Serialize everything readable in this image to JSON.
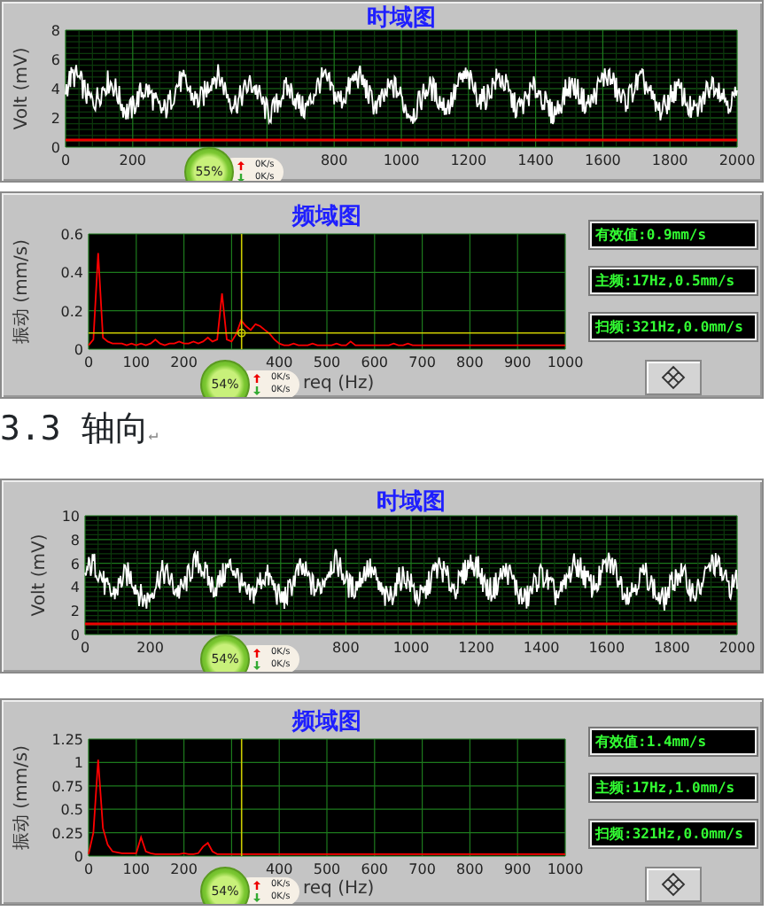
{
  "sections": [
    {
      "kind": "time",
      "title": "时域图",
      "ylabel": "Volt (mV)",
      "yticks": [
        "8",
        "6",
        "4",
        "2",
        "0"
      ],
      "xticks": [
        "0",
        "200",
        "800",
        "1000",
        "1200",
        "1400",
        "1600",
        "1800",
        "2000"
      ],
      "widget": {
        "percent": "55%",
        "up": "0K/s",
        "down": "0K/s"
      }
    },
    {
      "kind": "freq",
      "chart_data": {
        "type": "line",
        "title": "频域图",
        "xlabel": "req (Hz)",
        "ylabel": "振动 (mm/s)",
        "x": [
          0,
          10,
          20,
          30,
          40,
          50,
          60,
          70,
          80,
          90,
          100,
          110,
          120,
          130,
          140,
          150,
          160,
          170,
          180,
          190,
          200,
          210,
          220,
          230,
          240,
          250,
          260,
          270,
          280,
          290,
          300,
          310,
          320,
          330,
          340,
          350,
          360,
          370,
          380,
          390,
          400,
          410,
          420,
          430,
          440,
          450,
          460,
          470,
          480,
          490,
          500,
          510,
          520,
          530,
          540,
          550,
          560,
          570,
          580,
          590,
          600,
          610,
          620,
          630,
          640,
          650,
          660,
          670,
          680,
          690,
          700,
          710,
          720,
          730,
          740,
          750,
          760,
          770,
          780,
          790,
          800,
          810,
          820,
          830,
          840,
          850,
          860,
          870,
          880,
          890,
          900,
          910,
          920,
          930,
          940,
          950,
          960,
          970,
          980,
          990,
          1000
        ],
        "series": [
          {
            "color": "#ff0000",
            "values": [
              0.02,
              0.05,
              0.5,
              0.06,
              0.04,
              0.03,
              0.03,
              0.03,
              0.02,
              0.03,
              0.02,
              0.03,
              0.02,
              0.03,
              0.05,
              0.03,
              0.02,
              0.03,
              0.03,
              0.04,
              0.03,
              0.03,
              0.04,
              0.03,
              0.04,
              0.06,
              0.04,
              0.05,
              0.29,
              0.05,
              0.04,
              0.08,
              0.15,
              0.12,
              0.1,
              0.13,
              0.12,
              0.1,
              0.08,
              0.05,
              0.03,
              0.02,
              0.02,
              0.03,
              0.02,
              0.02,
              0.02,
              0.03,
              0.02,
              0.02,
              0.02,
              0.02,
              0.03,
              0.02,
              0.02,
              0.04,
              0.02,
              0.02,
              0.02,
              0.02,
              0.02,
              0.02,
              0.02,
              0.02,
              0.03,
              0.02,
              0.02,
              0.03,
              0.02,
              0.02,
              0.02,
              0.02,
              0.02,
              0.02,
              0.02,
              0.02,
              0.02,
              0.02,
              0.02,
              0.02,
              0.02,
              0.02,
              0.02,
              0.02,
              0.02,
              0.02,
              0.02,
              0.02,
              0.02,
              0.02,
              0.02,
              0.02,
              0.02,
              0.02,
              0.02,
              0.02,
              0.02,
              0.02,
              0.02,
              0.02,
              0.02
            ]
          }
        ],
        "xlim": [
          0,
          1000
        ],
        "ylim": [
          0,
          0.6
        ],
        "xticks": [
          0,
          100,
          200,
          400,
          500,
          600,
          700,
          800,
          900,
          1000
        ],
        "yticks": [
          0,
          0.2,
          0.4,
          0.6
        ],
        "grid": true,
        "ref_lines": [
          {
            "axis": "x",
            "value": 321,
            "color": "#cccc00"
          },
          {
            "axis": "y",
            "value": 0.084,
            "color": "#cccc00"
          }
        ]
      },
      "readouts": [
        "有效值:0.9mm/s",
        "主频:17Hz,0.5mm/s",
        "扫频:321Hz,0.0mm/s"
      ],
      "widget": {
        "percent": "54%",
        "up": "0K/s",
        "down": "0K/s"
      }
    },
    {
      "kind": "heading",
      "text": "3.3 轴向",
      "mark": "↵"
    },
    {
      "kind": "time",
      "title": "时域图",
      "ylabel": "Volt (mV)",
      "yticks": [
        "10",
        "8",
        "6",
        "4",
        "2",
        "0"
      ],
      "xticks": [
        "0",
        "200",
        "800",
        "1000",
        "1200",
        "1400",
        "1600",
        "1800",
        "2000"
      ],
      "widget": {
        "percent": "54%",
        "up": "0K/s",
        "down": "0K/s"
      }
    },
    {
      "kind": "freq",
      "chart_data": {
        "type": "line",
        "title": "频域图",
        "xlabel": "req (Hz)",
        "ylabel": "振动 (mm/s)",
        "x": [
          0,
          10,
          20,
          30,
          40,
          50,
          60,
          70,
          80,
          90,
          100,
          110,
          120,
          130,
          140,
          150,
          160,
          170,
          180,
          190,
          200,
          210,
          220,
          230,
          240,
          250,
          260,
          270,
          280,
          290,
          300,
          310,
          320,
          330,
          340,
          350,
          360,
          370,
          380,
          390,
          400,
          410,
          420,
          430,
          440,
          450,
          460,
          470,
          480,
          490,
          500,
          510,
          520,
          530,
          540,
          550,
          560,
          570,
          580,
          590,
          600,
          610,
          620,
          630,
          640,
          650,
          660,
          670,
          680,
          690,
          700,
          710,
          720,
          730,
          740,
          750,
          760,
          770,
          780,
          790,
          800,
          810,
          820,
          830,
          840,
          850,
          860,
          870,
          880,
          890,
          900,
          910,
          920,
          930,
          940,
          950,
          960,
          970,
          980,
          990,
          1000
        ],
        "series": [
          {
            "color": "#ff0000",
            "values": [
              0.02,
              0.25,
              1.03,
              0.3,
              0.12,
              0.05,
              0.04,
              0.03,
              0.03,
              0.03,
              0.03,
              0.2,
              0.05,
              0.03,
              0.02,
              0.02,
              0.02,
              0.02,
              0.02,
              0.02,
              0.03,
              0.02,
              0.02,
              0.03,
              0.1,
              0.14,
              0.05,
              0.02,
              0.02,
              0.02,
              0.02,
              0.02,
              0.02,
              0.02,
              0.02,
              0.02,
              0.02,
              0.02,
              0.02,
              0.02,
              0.02,
              0.02,
              0.02,
              0.02,
              0.02,
              0.02,
              0.02,
              0.02,
              0.02,
              0.02,
              0.02,
              0.02,
              0.02,
              0.02,
              0.02,
              0.02,
              0.02,
              0.02,
              0.02,
              0.02,
              0.02,
              0.02,
              0.02,
              0.02,
              0.02,
              0.02,
              0.02,
              0.02,
              0.02,
              0.02,
              0.02,
              0.02,
              0.02,
              0.02,
              0.02,
              0.02,
              0.02,
              0.02,
              0.02,
              0.02,
              0.02,
              0.02,
              0.02,
              0.02,
              0.02,
              0.02,
              0.02,
              0.02,
              0.02,
              0.02,
              0.02,
              0.02,
              0.02,
              0.02,
              0.02,
              0.02,
              0.02,
              0.02,
              0.02,
              0.02,
              0.02
            ]
          }
        ],
        "xlim": [
          0,
          1000
        ],
        "ylim": [
          0,
          1.25
        ],
        "xticks": [
          0,
          100,
          200,
          400,
          500,
          600,
          700,
          800,
          900,
          1000
        ],
        "yticks": [
          0,
          0.25,
          0.5,
          0.75,
          1,
          1.25
        ],
        "grid": true,
        "ref_lines": [
          {
            "axis": "x",
            "value": 321,
            "color": "#cccc00"
          }
        ]
      },
      "readouts": [
        "有效值:1.4mm/s",
        "主频:17Hz,1.0mm/s",
        "扫频:321Hz,0.0mm/s"
      ],
      "widget": {
        "percent": "54%",
        "up": "0K/s",
        "down": "0K/s"
      }
    }
  ]
}
